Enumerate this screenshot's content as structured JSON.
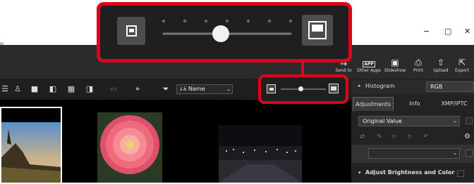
{
  "window": {
    "title_fragment": "o",
    "controls": [
      "−",
      "▢",
      "✕"
    ]
  },
  "toolbar": {
    "buttons": [
      {
        "label": "Send to",
        "icon": "send-icon"
      },
      {
        "label": "Other Apps",
        "icon": "app-icon"
      },
      {
        "label": "Slideshow",
        "icon": "slideshow-icon"
      },
      {
        "label": "Print",
        "icon": "print-icon"
      },
      {
        "label": "Upload",
        "icon": "upload-icon"
      },
      {
        "label": "Export",
        "icon": "export-icon"
      }
    ],
    "app_badge": "APP"
  },
  "toolbar2": {
    "sort_label": "Name",
    "sort_icon_text": "↓ā",
    "thumbnail_size_fraction": 0.45
  },
  "callout": {
    "thumbnail_size_fraction": 0.45,
    "tick_count": 7
  },
  "right_panel": {
    "histogram_label": "Histogram",
    "histogram_channel": "RGB",
    "tabs": [
      "Adjustments",
      "Info",
      "XMP/IPTC"
    ],
    "preset_value": "Original Value",
    "section_title": "Adjust Brightness and Color"
  },
  "colors": {
    "highlight": "#e0001a",
    "panel_dark": "#232323"
  }
}
